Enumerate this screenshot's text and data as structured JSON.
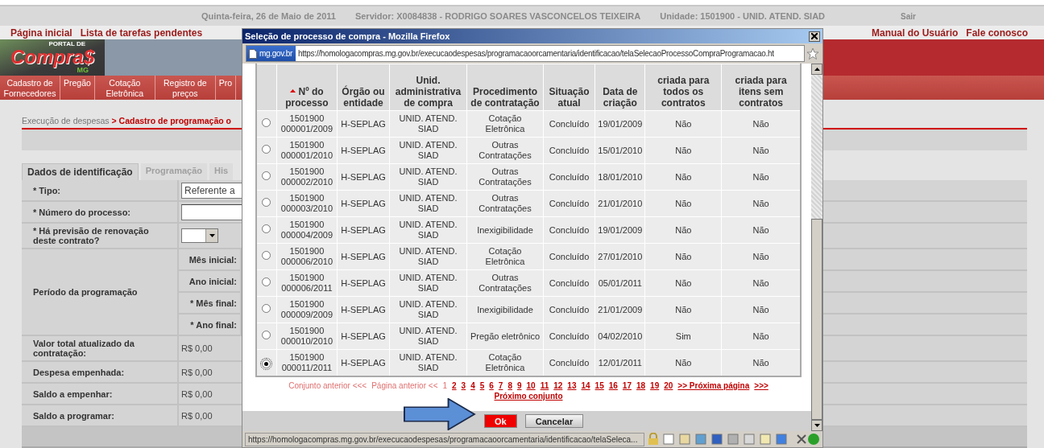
{
  "top_bar": {
    "date": "Quinta-feira, 26 de Maio de 2011",
    "server": "Servidor: X0084838 - RODRIGO SOARES VASCONCELOS TEIXEIRA",
    "unit": "Unidade: 1501900 - UNID. ATEND. SIAD",
    "logout": "Sair"
  },
  "top_links": [
    "Página inicial",
    "Lista de tarefas pendentes"
  ],
  "help_links": [
    "Manual do Usuário",
    "Fale conosco"
  ],
  "logo": {
    "tagline": "PORTAL DE",
    "name": "Compra$",
    "region": "MG"
  },
  "nav": [
    "Cadastro de Fornecedores",
    "Pregão",
    "Cotação Eletrônica",
    "Registro de preços",
    "Pro"
  ],
  "breadcrumb": {
    "parent": "Execução de despesas",
    "current": "> Cadastro de programação o"
  },
  "tabs": [
    {
      "label": "Dados de identificação",
      "selected": true
    },
    {
      "label": "Programação",
      "selected": false
    },
    {
      "label": "His",
      "selected": false
    }
  ],
  "form": {
    "rows": [
      {
        "kind": "select",
        "label": "* Tipo:",
        "value": "Referente a"
      },
      {
        "kind": "input",
        "label": "* Número do processo:"
      },
      {
        "kind": "dropdown",
        "label": "* Há previsão de renovação deste contrato?"
      },
      {
        "kind": "period",
        "label": "Período da programação",
        "fields": [
          "Mês inicial:",
          "Ano inicial:",
          "* Mês final:",
          "* Ano final:"
        ]
      },
      {
        "kind": "amount",
        "label": "Valor total atualizado da contratação:",
        "value": "R$ 0,00"
      },
      {
        "kind": "amount",
        "label": "Despesa empenhada:",
        "value": "R$ 0,00"
      },
      {
        "kind": "amount",
        "label": "Saldo a empenhar:",
        "value": "R$ 0,00"
      },
      {
        "kind": "amount",
        "label": "Saldo a programar:",
        "value": "R$ 0,00"
      }
    ]
  },
  "popup": {
    "title": "Seleção de processo de compra - Mozilla Firefox",
    "site": "mg.gov.br",
    "url": "https://homologacompras.mg.gov.br/execucaodespesas/programacaoorcamentaria/identificacao/telaSelecaoProcessoCompraProgramacao.ht",
    "table": {
      "columns": [
        "Nº do processo",
        "Órgão ou entidade",
        "Unid. administrativa de compra",
        "Procedimento de contratação",
        "Situação atual",
        "Data de criação",
        "criada para todos os contratos",
        "criada para itens sem contratos"
      ],
      "rows": [
        {
          "selected": false,
          "cells": [
            "1501900 000001/2009",
            "H-SEPLAG",
            "UNID. ATEND. SIAD",
            "Cotação Eletrônica",
            "Concluído",
            "19/01/2009",
            "Não",
            "Não"
          ]
        },
        {
          "selected": false,
          "cells": [
            "1501900 000001/2010",
            "H-SEPLAG",
            "UNID. ATEND. SIAD",
            "Outras Contratações",
            "Concluído",
            "15/01/2010",
            "Não",
            "Não"
          ]
        },
        {
          "selected": false,
          "cells": [
            "1501900 000002/2010",
            "H-SEPLAG",
            "UNID. ATEND. SIAD",
            "Outras Contratações",
            "Concluído",
            "18/01/2010",
            "Não",
            "Não"
          ]
        },
        {
          "selected": false,
          "cells": [
            "1501900 000003/2010",
            "H-SEPLAG",
            "UNID. ATEND. SIAD",
            "Outras Contratações",
            "Concluído",
            "21/01/2010",
            "Não",
            "Não"
          ]
        },
        {
          "selected": false,
          "cells": [
            "1501900 000004/2009",
            "H-SEPLAG",
            "UNID. ATEND. SIAD",
            "Inexigibilidade",
            "Concluído",
            "19/01/2009",
            "Não",
            "Não"
          ]
        },
        {
          "selected": false,
          "cells": [
            "1501900 000006/2010",
            "H-SEPLAG",
            "UNID. ATEND. SIAD",
            "Cotação Eletrônica",
            "Concluído",
            "27/01/2010",
            "Não",
            "Não"
          ]
        },
        {
          "selected": false,
          "cells": [
            "1501900 000006/2011",
            "H-SEPLAG",
            "UNID. ATEND. SIAD",
            "Outras Contratações",
            "Concluído",
            "05/01/2011",
            "Não",
            "Não"
          ]
        },
        {
          "selected": false,
          "cells": [
            "1501900 000009/2009",
            "H-SEPLAG",
            "UNID. ATEND. SIAD",
            "Inexigibilidade",
            "Concluído",
            "21/01/2009",
            "Não",
            "Não"
          ]
        },
        {
          "selected": false,
          "cells": [
            "1501900 000010/2010",
            "H-SEPLAG",
            "UNID. ATEND. SIAD",
            "Pregão eletrônico",
            "Concluído",
            "04/02/2010",
            "Sim",
            "Não"
          ]
        },
        {
          "selected": true,
          "cells": [
            "1501900 000011/2011",
            "H-SEPLAG",
            "UNID. ATEND. SIAD",
            "Cotação Eletrônica",
            "Concluído",
            "12/01/2011",
            "Não",
            "Não"
          ]
        }
      ]
    },
    "pagination": {
      "before": [
        {
          "label": "Conjunto anterior <<<",
          "disabled": true
        },
        {
          "label": "Página anterior <<",
          "disabled": true
        }
      ],
      "pages": [
        {
          "label": "1",
          "selected": true
        },
        {
          "label": "2",
          "selected": false
        },
        {
          "label": "3",
          "selected": false
        },
        {
          "label": "4",
          "selected": false
        },
        {
          "label": "5",
          "selected": false
        },
        {
          "label": "6",
          "selected": false
        },
        {
          "label": "7",
          "selected": false
        },
        {
          "label": "8",
          "selected": false
        },
        {
          "label": "9",
          "selected": false
        },
        {
          "label": "10",
          "selected": false
        },
        {
          "label": "11",
          "selected": false
        },
        {
          "label": "12",
          "selected": false
        },
        {
          "label": "13",
          "selected": false
        },
        {
          "label": "14",
          "selected": false
        },
        {
          "label": "15",
          "selected": false
        },
        {
          "label": "16",
          "selected": false
        },
        {
          "label": "17",
          "selected": false
        },
        {
          "label": "18",
          "selected": false
        },
        {
          "label": "19",
          "selected": false
        },
        {
          "label": "20",
          "selected": false
        }
      ],
      "after": [
        {
          "label": ">> Próxima página",
          "disabled": false
        },
        {
          "label": ">>>",
          "disabled": false
        },
        {
          "label": "Próximo conjunto",
          "disabled": false
        }
      ]
    },
    "buttons": [
      {
        "label": "Ok",
        "kind": "primary"
      },
      {
        "label": "Cancelar",
        "kind": "secondary"
      }
    ],
    "status_url": "https://homologacompras.mg.gov.br/execucaodespesas/programacaoorcamentaria/identificacao/telaSeleca..."
  }
}
